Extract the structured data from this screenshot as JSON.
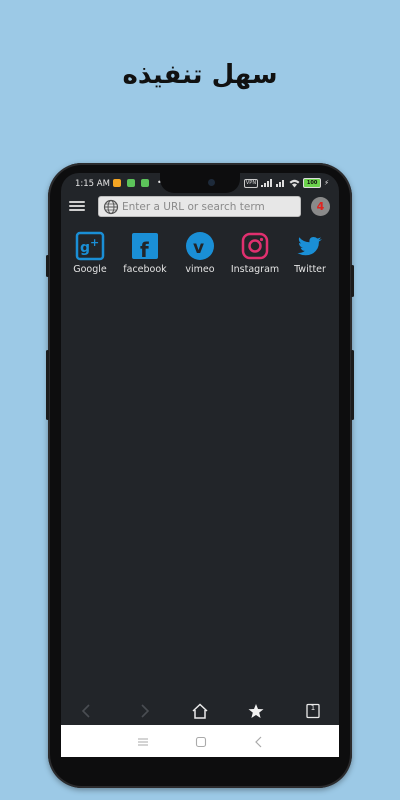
{
  "headline": "سهل تنفيذه",
  "status_bar": {
    "time": "1:15 AM",
    "vpn_label": "VPN",
    "battery_level": "100",
    "app_icon_colors": [
      "#f5a623",
      "#5cc35a",
      "#5cc35a"
    ]
  },
  "toolbar": {
    "menu_icon": "hamburger-menu-icon",
    "url_placeholder": "Enter a URL or search term",
    "tab_count": "4",
    "tab_count_color": "#e0221f"
  },
  "speed_dial": [
    {
      "label": "Google",
      "icon": "google-plus-icon",
      "color": "#1a8fd6"
    },
    {
      "label": "facebook",
      "icon": "facebook-icon",
      "color": "#1a8fd6"
    },
    {
      "label": "vimeo",
      "icon": "vimeo-icon",
      "color": "#1a8fd6"
    },
    {
      "label": "Instagram",
      "icon": "instagram-icon",
      "color": "#e0306f"
    },
    {
      "label": "Twitter",
      "icon": "twitter-icon",
      "color": "#1a8fd6"
    }
  ],
  "bottom_nav": {
    "tab_switcher_count": "1"
  },
  "colors": {
    "background": "#9cc9e6",
    "screen": "#222529",
    "accent": "#1a8fd6"
  }
}
